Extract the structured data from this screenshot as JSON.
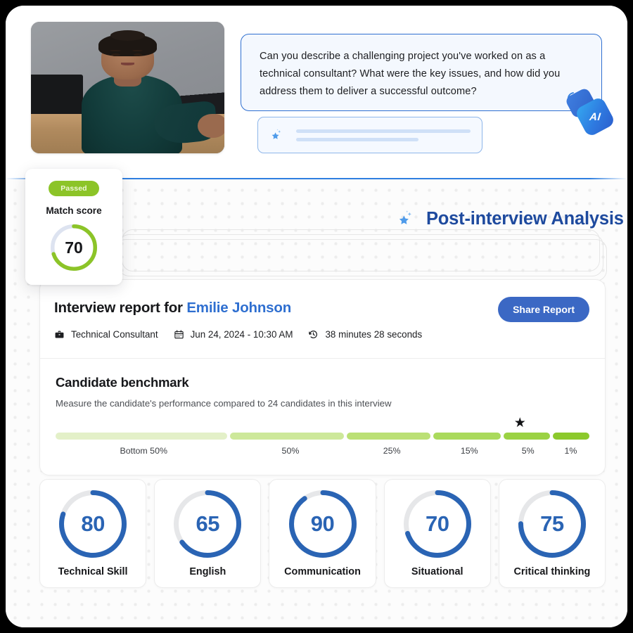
{
  "interview": {
    "question": "Can you describe a challenging project you've worked on as a technical consultant? What were the key issues, and how did you address them to deliver a successful outcome?",
    "ai_badge_label": "AI",
    "video_alt": "candidate-video-thumbnail"
  },
  "analysis": {
    "heading": "Post-interview Analysis"
  },
  "match": {
    "status_badge": "Passed",
    "label": "Match score",
    "value": "70",
    "value_num": 70,
    "ring_color": "#8cc428",
    "track_color": "#dde3f0"
  },
  "report": {
    "title_prefix": "Interview report for ",
    "candidate_name": "Emilie Johnson",
    "share_label": "Share Report",
    "meta": {
      "role": "Technical Consultant",
      "datetime": "Jun 24, 2024 - 10:30 AM",
      "duration": "38 minutes 28 seconds"
    }
  },
  "benchmark": {
    "title": "Candidate benchmark",
    "subtitle": "Measure the candidate's performance compared to 24 candidates in this interview",
    "candidate_marker_percent": 87,
    "segments": [
      {
        "label": "Bottom 50%",
        "width": 33,
        "color": "#e3f0c8"
      },
      {
        "label": "50%",
        "width": 22,
        "color": "#cde89a"
      },
      {
        "label": "25%",
        "width": 16,
        "color": "#bbe075"
      },
      {
        "label": "15%",
        "width": 13,
        "color": "#aada5c"
      },
      {
        "label": "5%",
        "width": 9,
        "color": "#9bd243"
      },
      {
        "label": "1%",
        "width": 7,
        "color": "#8cc92c"
      }
    ]
  },
  "scores": {
    "ring_color": "#2a64b4",
    "track_color": "#e6e7e9",
    "items": [
      {
        "label": "Technical Skill",
        "value": "80",
        "value_num": 80
      },
      {
        "label": "English",
        "value": "65",
        "value_num": 65
      },
      {
        "label": "Communication",
        "value": "90",
        "value_num": 90
      },
      {
        "label": "Situational",
        "value": "70",
        "value_num": 70
      },
      {
        "label": "Critical thinking",
        "value": "75",
        "value_num": 75
      }
    ]
  },
  "icons": {
    "sparkle_star": "sparkle-star-icon",
    "briefcase": "briefcase-icon",
    "calendar": "calendar-icon",
    "history": "history-clock-icon",
    "benchmark_star": "★"
  }
}
